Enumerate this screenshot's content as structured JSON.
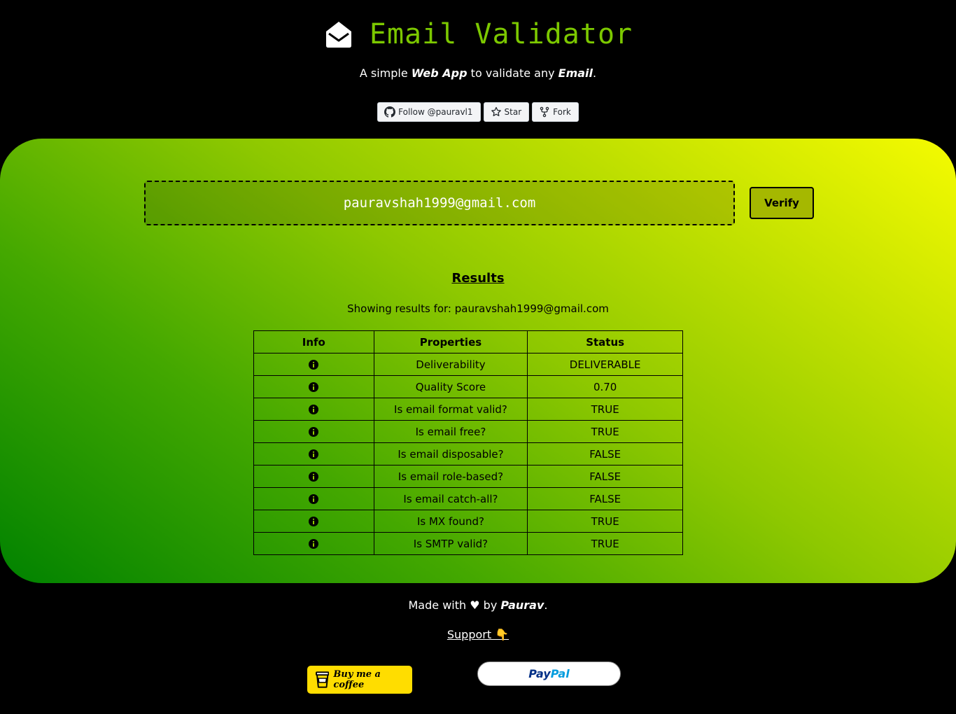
{
  "header": {
    "title": "Email Validator",
    "subtitle": {
      "part1": "A simple ",
      "bold1": "Web App",
      "part2": " to validate any ",
      "bold2": "Email",
      "part3": "."
    },
    "github_buttons": [
      {
        "label": "Follow @pauravl1",
        "icon": "github-icon"
      },
      {
        "label": "Star",
        "icon": "star-icon"
      },
      {
        "label": "Fork",
        "icon": "fork-icon"
      }
    ]
  },
  "form": {
    "email_value": "pauravshah1999@gmail.com",
    "verify_label": "Verify"
  },
  "results": {
    "heading": "Results",
    "showing": "Showing results for: pauravshah1999@gmail.com",
    "columns": [
      "Info",
      "Properties",
      "Status"
    ],
    "rows": [
      {
        "property": "Deliverability",
        "status": "DELIVERABLE"
      },
      {
        "property": "Quality Score",
        "status": "0.70"
      },
      {
        "property": "Is email format valid?",
        "status": "TRUE"
      },
      {
        "property": "Is email free?",
        "status": "TRUE"
      },
      {
        "property": "Is email disposable?",
        "status": "FALSE"
      },
      {
        "property": "Is email role-based?",
        "status": "FALSE"
      },
      {
        "property": "Is email catch-all?",
        "status": "FALSE"
      },
      {
        "property": "Is MX found?",
        "status": "TRUE"
      },
      {
        "property": "Is SMTP valid?",
        "status": "TRUE"
      }
    ]
  },
  "footer": {
    "made_with_pre": "Made with ",
    "heart": "♥",
    "made_with_by": " by ",
    "author": "Paurav",
    "made_with_post": ".",
    "support_label": "Support 👇",
    "coffee_label": "Buy me a coffee",
    "paypal_label_1": "Pay",
    "paypal_label_2": "Pal"
  },
  "colors": {
    "title_green": "#7cc800",
    "gradient_start": "#008200",
    "gradient_end": "#f5fb00",
    "verify_bg": "#a5b800",
    "coffee_yellow": "#ffdd00"
  }
}
